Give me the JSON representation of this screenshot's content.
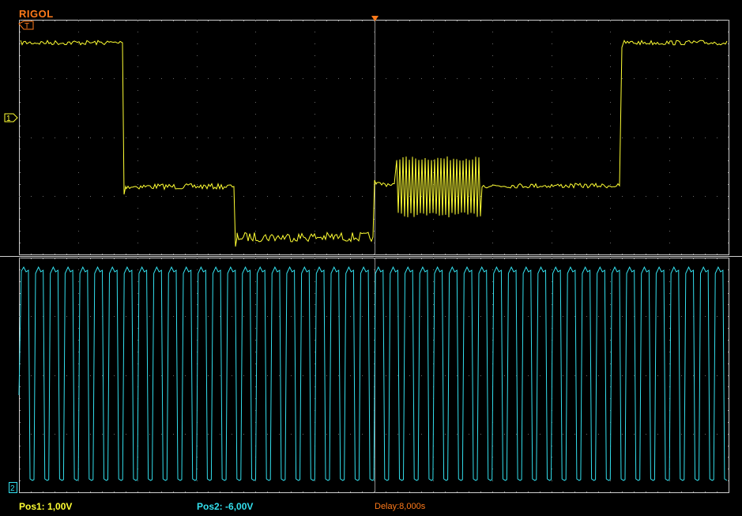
{
  "brand": "RIGOL",
  "markers": {
    "trigger": "T",
    "ch1": "1",
    "ch2": "2"
  },
  "status": {
    "pos1_label": "Pos1:",
    "pos1_value": "1,00V",
    "pos2_label": "Pos2:",
    "pos2_value": "-6,00V",
    "delay": "Delay:8,000s"
  },
  "colors": {
    "ch1": "#ffff33",
    "ch2": "#33e0ee",
    "brand": "#ff7a1a",
    "grid": "#c8c8c8"
  }
}
